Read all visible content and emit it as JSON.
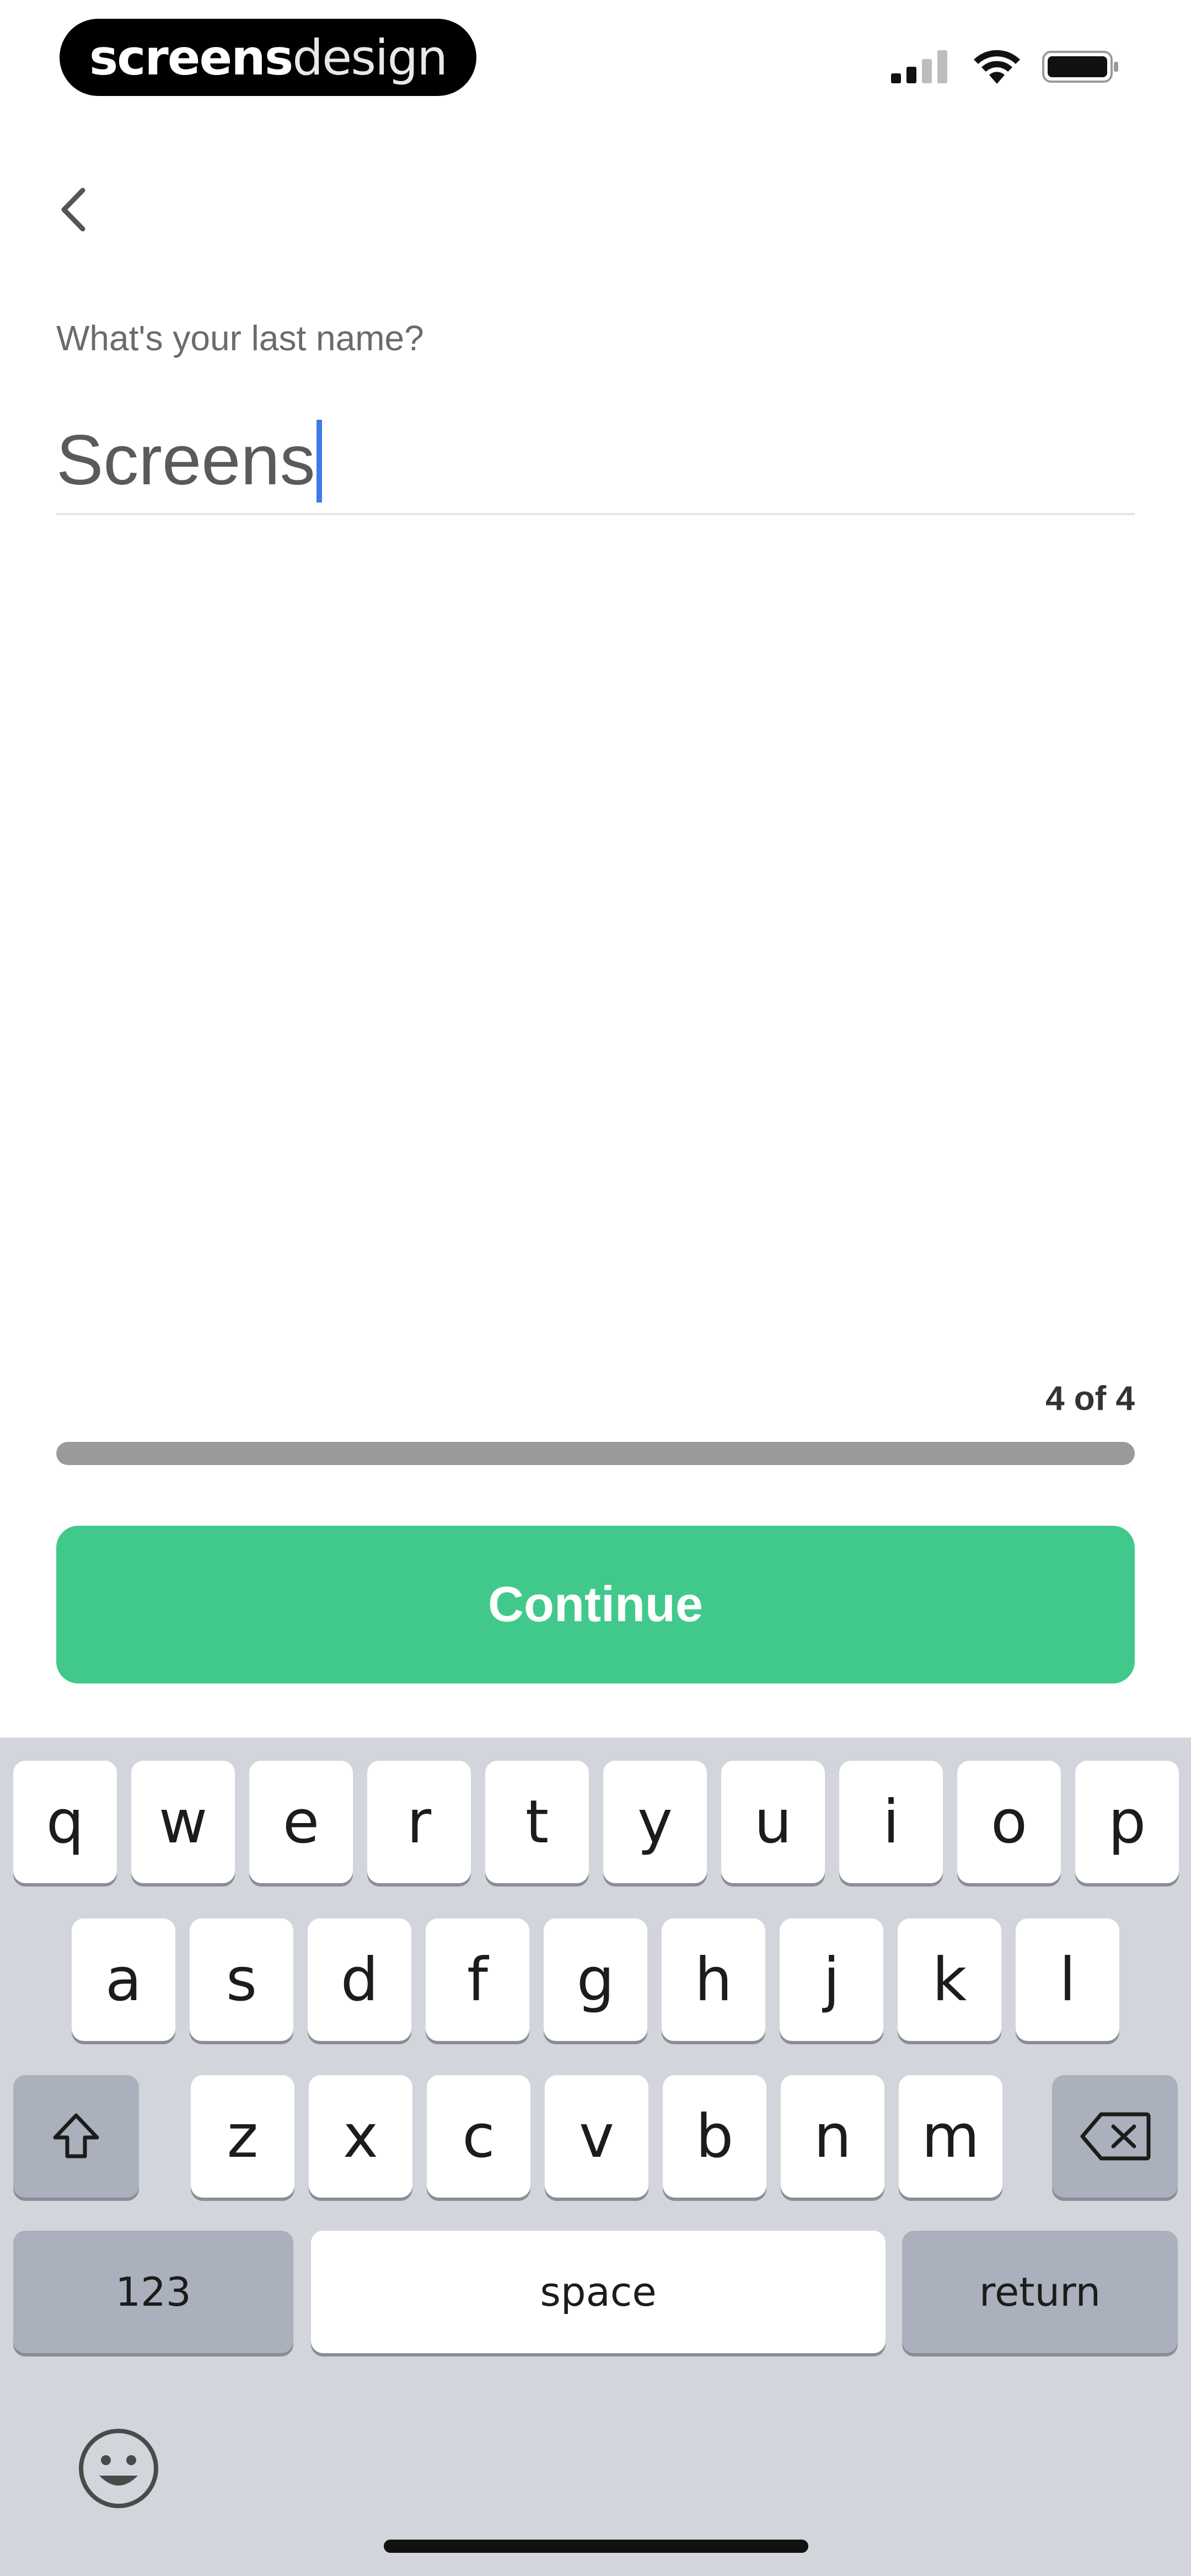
{
  "status_bar": {
    "brand_bold": "screens",
    "brand_light": "design",
    "icons": [
      "cellular-signal-icon",
      "wifi-icon",
      "battery-icon"
    ]
  },
  "header": {
    "back_icon": "chevron-left-icon"
  },
  "form": {
    "question": "What's your last name?",
    "input_value": "Screens"
  },
  "progress": {
    "label": "4 of 4",
    "value": 1.0
  },
  "continue_label": "Continue",
  "colors": {
    "accent": "#41c98b",
    "caret": "#3b7de8",
    "keyboard_bg": "#d3d5dc"
  },
  "keyboard": {
    "row1": [
      "q",
      "w",
      "e",
      "r",
      "t",
      "y",
      "u",
      "i",
      "o",
      "p"
    ],
    "row2": [
      "a",
      "s",
      "d",
      "f",
      "g",
      "h",
      "j",
      "k",
      "l"
    ],
    "row3": [
      "z",
      "x",
      "c",
      "v",
      "b",
      "n",
      "m"
    ],
    "numbers_label": "123",
    "space_label": "space",
    "return_label": "return",
    "shift_icon": "shift-icon",
    "delete_icon": "delete-icon",
    "emoji_icon": "emoji-icon"
  }
}
